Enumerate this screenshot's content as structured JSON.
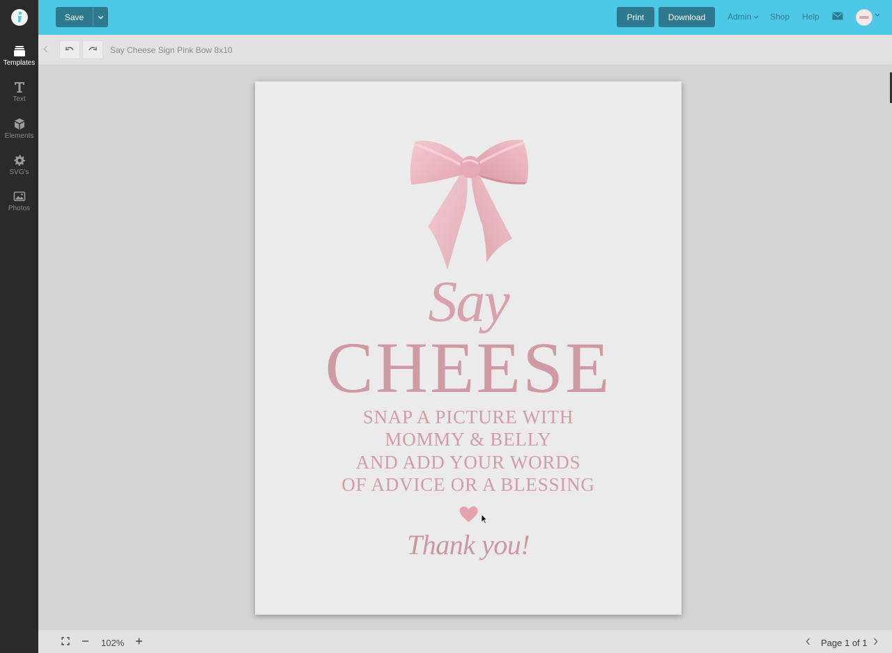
{
  "sidebar": {
    "items": [
      {
        "label": "Templates",
        "icon": "layers-icon",
        "active": true
      },
      {
        "label": "Text",
        "icon": "text-icon"
      },
      {
        "label": "Elements",
        "icon": "cube-icon"
      },
      {
        "label": "SVG's",
        "icon": "gear-icon"
      },
      {
        "label": "Photos",
        "icon": "image-icon"
      }
    ]
  },
  "topbar": {
    "save_label": "Save",
    "print_label": "Print",
    "download_label": "Download",
    "admin_label": "Admin",
    "shop_label": "Shop",
    "help_label": "Help",
    "accent_color": "#4dc8e6",
    "button_color": "#2d7a8e"
  },
  "toolbar": {
    "doc_title": "Say Cheese Sign Pink Bow 8x10"
  },
  "page": {
    "say": "Say",
    "cheese": "CHEESE",
    "lines": [
      "SNAP A PICTURE WITH",
      "MOMMY & BELLY",
      "AND ADD YOUR WORDS",
      "OF ADVICE OR A BLESSING"
    ],
    "thanks": "Thank you!",
    "text_color": "#d19aa3"
  },
  "bottombar": {
    "zoom": "102%",
    "page_indicator": "Page 1 of 1"
  }
}
